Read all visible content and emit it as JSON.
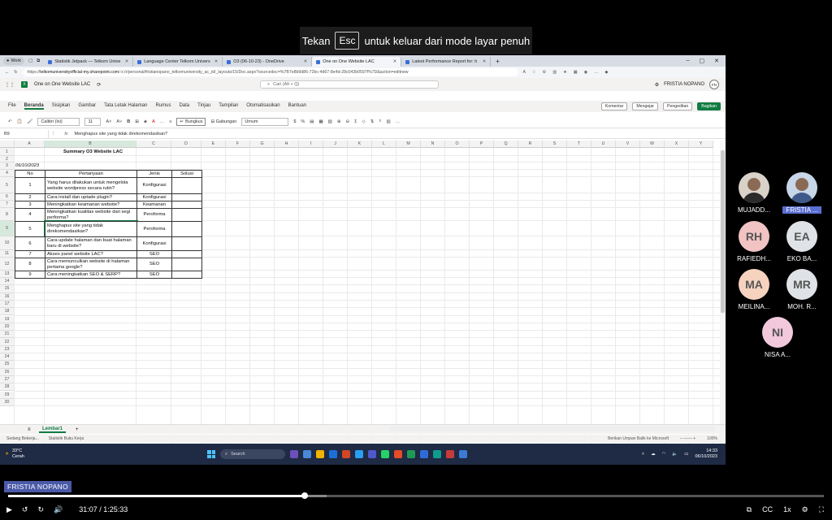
{
  "banner": {
    "pre": "Tekan",
    "key": "Esc",
    "post": "untuk keluar dari mode layar penuh"
  },
  "browser": {
    "profile": "Work",
    "tabs": [
      {
        "label": "Statistik Jetpack — Telkom Unive",
        "active": false
      },
      {
        "label": "Language Center Telkom Univers",
        "active": false
      },
      {
        "label": "O3 (06-10-23) - OneDrive",
        "active": false
      },
      {
        "label": "One on One Website LAC",
        "active": true
      },
      {
        "label": "Latest Performance Report for: h",
        "active": false
      }
    ],
    "url_prefix": "https://",
    "url_host": "telkomuniversityofficial-my.sharepoint.com",
    "url_rest": "/:x:/r/personal/fristianopano_telkomuniversity_ac_id/_layouts/15/Doc.aspx?sourcedoc=%7B7e8b9d86-72bc-4d67-8e4d-28c043b0597f%7D&action=editnew"
  },
  "office": {
    "doc_title": "One on One Website LAC",
    "search_placeholder": "Cari (Alt + Q)",
    "user_name": "FRISTIA NOPANO",
    "user_initials": "FN"
  },
  "menus": [
    "File",
    "Beranda",
    "Sisipkan",
    "Gambar",
    "Tata Letak Halaman",
    "Rumus",
    "Data",
    "Tinjau",
    "Tampilan",
    "Otomatisasikan",
    "Bantuan"
  ],
  "menu_buttons": {
    "comment": "Komentar",
    "catchup": "Mengejar",
    "editing": "Pengeditan",
    "share": "Bagikan"
  },
  "ribbon": {
    "font": "Calibri (Isi)",
    "size": "11",
    "wrap": "Bungkus",
    "merge": "Gabungan",
    "format": "Umum"
  },
  "formula": {
    "cell": "B9",
    "content": "Menghapus site yang tidak direkomendasikan?"
  },
  "columns": [
    "A",
    "B",
    "C",
    "D",
    "E",
    "F",
    "G",
    "H",
    "I",
    "J",
    "K",
    "L",
    "M",
    "N",
    "O",
    "P",
    "Q",
    "R",
    "S",
    "T",
    "U",
    "V",
    "W",
    "X",
    "Y"
  ],
  "sheet": {
    "title": "Summary O3 Website LAC",
    "date": "06/10/2023",
    "headers": [
      "No",
      "Pertanyaan",
      "Jenis",
      "Solusi"
    ],
    "rows": [
      {
        "no": "1",
        "q": "Yang harus dilakukan untuk mengelola website wordpress secara rutin?",
        "type": "Konfigurasi"
      },
      {
        "no": "2",
        "q": "Cara install dan uptade plugin?",
        "type": "Konfigurasi"
      },
      {
        "no": "3",
        "q": "Meningkatkan keamanan website?",
        "type": "Keamanan"
      },
      {
        "no": "4",
        "q": "Meningkatkan kualitas website dari segi performa?",
        "type": "Peroforma"
      },
      {
        "no": "5",
        "q": "Menghapus site yang tidak direkomendasikan?",
        "type": "Peroforma"
      },
      {
        "no": "6",
        "q": "Cara update halaman dan buat halaman baru di website?",
        "type": "Konfigurasi"
      },
      {
        "no": "7",
        "q": "Akses panel website LAC?",
        "type": "SEO"
      },
      {
        "no": "8",
        "q": "Cara memunculkan website di halaman pertama google?",
        "type": "SEO"
      },
      {
        "no": "9",
        "q": "Cara meningkatkan SEO & SERP?",
        "type": "SEO"
      }
    ],
    "tab": "Lembar1"
  },
  "status": {
    "left1": "Sedang Bekerja...",
    "left2": "Statistik Buku Kerja",
    "feedback": "Berikan Umpan Balik ke Microsoft",
    "zoom": "100%"
  },
  "taskbar": {
    "temp": "33°C",
    "cond": "Cerah",
    "search": "Search",
    "time": "14:33",
    "date": "06/10/2023"
  },
  "participants": [
    {
      "name": "MUJADD...",
      "initials": "",
      "color": ""
    },
    {
      "name": "FRISTIA ...",
      "initials": "",
      "color": ""
    },
    {
      "name": "RAFIEDH...",
      "initials": "RH",
      "color": "#f2c3c3"
    },
    {
      "name": "EKO BA...",
      "initials": "EA",
      "color": "#dfe3e8"
    },
    {
      "name": "MEILINA...",
      "initials": "MA",
      "color": "#f6d3bf"
    },
    {
      "name": "MOH. R...",
      "initials": "MR",
      "color": "#dfe3e8"
    },
    {
      "name": "NISA A...",
      "initials": "NI",
      "color": "#f2c8dc"
    }
  ],
  "presenter": "FRISTIA NOPANO",
  "video": {
    "time": "31:07 / 1:25:33",
    "progress": 0.3636,
    "buffered": 0.39,
    "speed": "1x"
  }
}
